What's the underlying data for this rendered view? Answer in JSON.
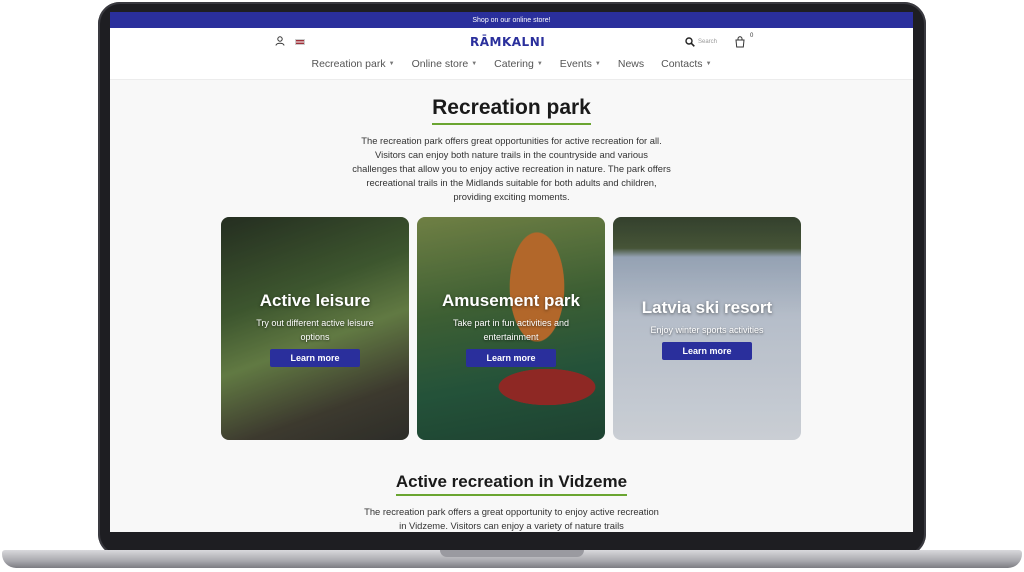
{
  "announcement": "Shop on our online store!",
  "header": {
    "logo": "RĀMKALNI",
    "search_label": "Search",
    "cart_count": "0",
    "icons": [
      "user-icon",
      "latvia-flag-icon",
      "search-icon",
      "cart-icon"
    ]
  },
  "nav": {
    "items": [
      {
        "label": "Recreation park",
        "dropdown": true
      },
      {
        "label": "Online store",
        "dropdown": true
      },
      {
        "label": "Catering",
        "dropdown": true
      },
      {
        "label": "Events",
        "dropdown": true
      },
      {
        "label": "News",
        "dropdown": false
      },
      {
        "label": "Contacts",
        "dropdown": true
      }
    ]
  },
  "main": {
    "title": "Recreation park",
    "intro": "The recreation park offers great opportunities for active recreation for all. Visitors can enjoy both nature trails in the countryside and various challenges that allow you to enjoy active recreation in nature. The park offers recreational trails in the Midlands suitable for both adults and children, providing exciting moments."
  },
  "cards": [
    {
      "title": "Active leisure",
      "subtitle": "Try out different active leisure options",
      "button": "Learn more"
    },
    {
      "title": "Amusement park",
      "subtitle": "Take part in fun activities and entertainment",
      "button": "Learn more"
    },
    {
      "title": "Latvia ski resort",
      "subtitle": "Enjoy winter sports activities",
      "button": "Learn more"
    }
  ],
  "section2": {
    "title": "Active recreation in Vidzeme",
    "text": "The recreation park offers a great opportunity to enjoy active recreation in Vidzeme. Visitors can enjoy a variety of nature trails"
  },
  "colors": {
    "brand": "#2a2f9c",
    "accent_underline": "#6aa531"
  }
}
